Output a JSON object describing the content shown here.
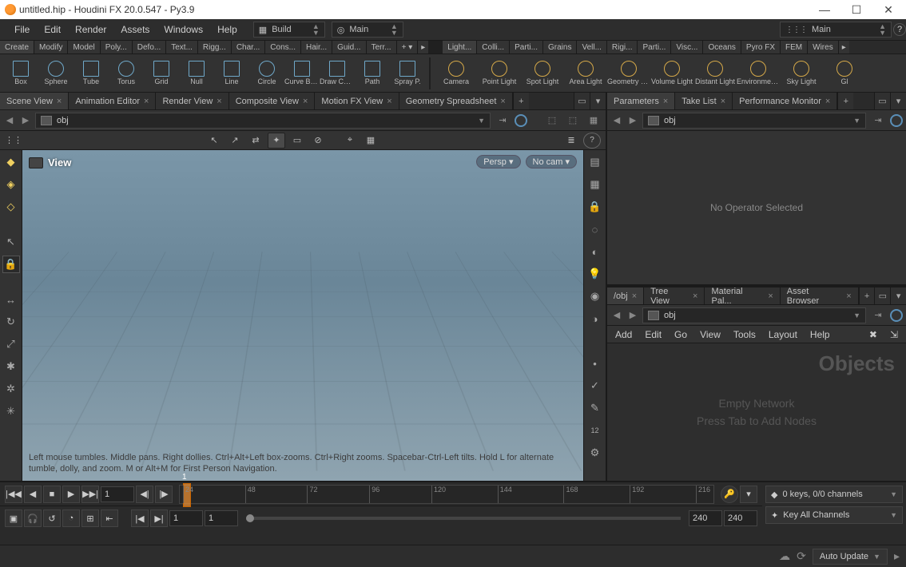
{
  "title": "untitled.hip - Houdini FX 20.0.547 - Py3.9",
  "menu": {
    "file": "File",
    "edit": "Edit",
    "render": "Render",
    "assets": "Assets",
    "windows": "Windows",
    "help": "Help"
  },
  "desktops": {
    "build": "Build",
    "main1": "Main",
    "main2": "Main"
  },
  "shelf_tabs_left": [
    "Create",
    "Modify",
    "Model",
    "Poly...",
    "Defo...",
    "Text...",
    "Rigg...",
    "Char...",
    "Cons...",
    "Hair...",
    "Guid...",
    "Terr..."
  ],
  "shelf_tabs_right": [
    "Light...",
    "Colli...",
    "Parti...",
    "Grains",
    "Vell...",
    "Rigi...",
    "Parti...",
    "Visc...",
    "Oceans",
    "Pyro FX",
    "FEM",
    "Wires"
  ],
  "shelf_items_left": [
    "Box",
    "Sphere",
    "Tube",
    "Torus",
    "Grid",
    "Null",
    "Line",
    "Circle",
    "Curve Bezier",
    "Draw Curve",
    "Path",
    "Spray P."
  ],
  "shelf_items_right": [
    "Camera",
    "Point Light",
    "Spot Light",
    "Area Light",
    "Geometry Light",
    "Volume Light",
    "Distant Light",
    "Environment Light",
    "Sky Light",
    "Gl"
  ],
  "left_pane_tabs": [
    {
      "label": "Scene View",
      "active": true
    },
    {
      "label": "Animation Editor",
      "active": false
    },
    {
      "label": "Render View",
      "active": false
    },
    {
      "label": "Composite View",
      "active": false
    },
    {
      "label": "Motion FX View",
      "active": false
    },
    {
      "label": "Geometry Spreadsheet",
      "active": false
    }
  ],
  "right_top_tabs": [
    {
      "label": "Parameters",
      "active": true
    },
    {
      "label": "Take List",
      "active": false
    },
    {
      "label": "Performance Monitor",
      "active": false
    }
  ],
  "right_bot_tabs": [
    {
      "label": "/obj",
      "active": true
    },
    {
      "label": "Tree View",
      "active": false
    },
    {
      "label": "Material Pal...",
      "active": false
    },
    {
      "label": "Asset Browser",
      "active": false
    }
  ],
  "path": "obj",
  "viewport": {
    "label": "View",
    "persp": "Persp",
    "nocam": "No cam",
    "hint": "Left mouse tumbles. Middle pans. Right dollies. Ctrl+Alt+Left box-zooms. Ctrl+Right zooms. Spacebar-Ctrl-Left tilts. Hold L for alternate tumble, dolly, and zoom. M or Alt+M for First Person Navigation."
  },
  "params_empty": "No Operator Selected",
  "netmenu": {
    "add": "Add",
    "edit": "Edit",
    "go": "Go",
    "view": "View",
    "tools": "Tools",
    "layout": "Layout",
    "help": "Help"
  },
  "network": {
    "title": "Objects",
    "empty1": "Empty Network",
    "empty2": "Press Tab to Add Nodes"
  },
  "timeline": {
    "frame": "1",
    "start": "1",
    "end": "240",
    "end2": "240",
    "ticks": [
      "24",
      "48",
      "72",
      "96",
      "120",
      "144",
      "168",
      "192",
      "216"
    ],
    "keys_label": "0 keys, 0/0 channels",
    "key_all": "Key All Channels"
  },
  "status": {
    "auto_update": "Auto Update"
  }
}
